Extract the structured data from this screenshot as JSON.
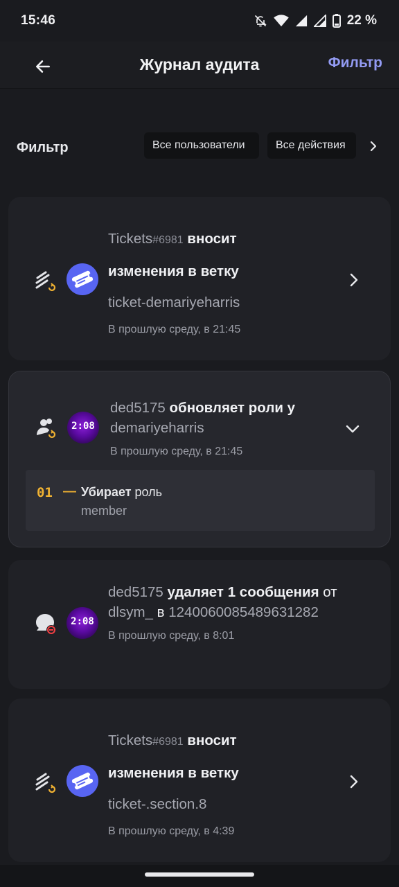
{
  "status_bar": {
    "time": "15:46",
    "battery_pct": "22 %",
    "icons": [
      "bell-off-icon",
      "wifi-icon",
      "signal-icon",
      "signal-icon",
      "battery-icon"
    ]
  },
  "app_bar": {
    "title": "Журнал аудита",
    "filter_link": "Фильтр",
    "back_icon": "arrow-left-icon"
  },
  "filter_row": {
    "label": "Фильтр",
    "chips": [
      "Все пользователи",
      "Все действия"
    ],
    "more_icon": "chevron-right-icon"
  },
  "entries": [
    {
      "user": "Tickets",
      "discriminator": "#6981",
      "action": "вносит изменения в ветку",
      "action_line1": "вносит",
      "action_line2": "изменения в ветку",
      "target": "ticket-demariyeharris",
      "time": "В прошлую среду, в 21:45",
      "icon": "thread-edit-icon",
      "avatar": "ticket-bot-avatar",
      "chevron": "chevron-right-icon"
    },
    {
      "user": "ded5175",
      "action": "обновляет роли у",
      "target": "demariyeharris",
      "time": "В прошлую среду, в 21:45",
      "icon": "member-role-update-icon",
      "avatar": "clock-avatar",
      "avatar_text": "2:08",
      "chevron": "chevron-down-icon",
      "change": {
        "number": "01",
        "dash": "—",
        "verb": "Убирает",
        "object": "роль",
        "value": "member"
      }
    },
    {
      "user": "ded5175",
      "action_a": "удаляет",
      "count": "1",
      "action_b": "сообщения",
      "from_word": "от",
      "from_user": "dlsym_",
      "in_word": "в",
      "channel": "1240060085489631282",
      "time": "В прошлую среду, в 8:01",
      "icon": "message-delete-icon",
      "avatar": "clock-avatar",
      "avatar_text": "2:08"
    },
    {
      "user": "Tickets",
      "discriminator": "#6981",
      "action_line1": "вносит",
      "action_line2": "изменения в ветку",
      "target": "ticket-.section.8",
      "time": "В прошлую среду, в 4:39",
      "icon": "thread-edit-icon",
      "avatar": "ticket-bot-avatar",
      "chevron": "chevron-right-icon"
    }
  ],
  "colors": {
    "background": "#1a1b1f",
    "card": "#202126",
    "accent": "#939bf3",
    "change_number": "#f0b232",
    "update_badge": "#f0b232",
    "delete_badge": "#f23f43"
  }
}
